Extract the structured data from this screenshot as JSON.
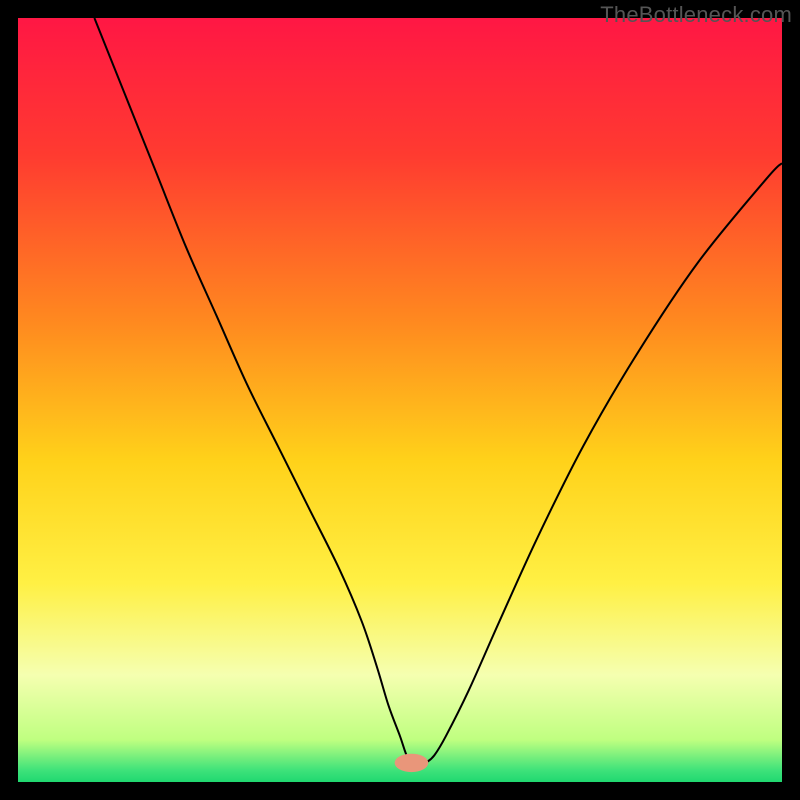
{
  "watermark": "TheBottleneck.com",
  "chart_data": {
    "type": "line",
    "title": "",
    "xlabel": "",
    "ylabel": "",
    "xlim": [
      0,
      100
    ],
    "ylim": [
      0,
      100
    ],
    "grid": false,
    "legend": false,
    "background_gradient": {
      "stops": [
        {
          "offset": 0.0,
          "color": "#ff1744"
        },
        {
          "offset": 0.18,
          "color": "#ff3b30"
        },
        {
          "offset": 0.4,
          "color": "#ff8a1f"
        },
        {
          "offset": 0.58,
          "color": "#ffd21a"
        },
        {
          "offset": 0.74,
          "color": "#fff044"
        },
        {
          "offset": 0.86,
          "color": "#f5ffb0"
        },
        {
          "offset": 0.945,
          "color": "#bfff80"
        },
        {
          "offset": 0.985,
          "color": "#3de27a"
        },
        {
          "offset": 1.0,
          "color": "#20d870"
        }
      ]
    },
    "marker": {
      "x": 51.5,
      "y": 2.5,
      "color": "#e9967a",
      "rx": 2.2,
      "ry": 1.2
    },
    "series": [
      {
        "name": "curve",
        "color": "#000000",
        "stroke_width": 2,
        "x": [
          10,
          14,
          18,
          22,
          26,
          30,
          34,
          38,
          42,
          45,
          47,
          48.5,
          50,
          51,
          52,
          53,
          53.5,
          54.5,
          56,
          59,
          63,
          68,
          74,
          81,
          89,
          98,
          100
        ],
        "y": [
          100,
          90,
          80,
          70,
          61,
          52,
          44,
          36,
          28,
          21,
          15,
          10,
          6,
          3.2,
          2.5,
          2.5,
          2.6,
          3.5,
          6,
          12,
          21,
          32,
          44,
          56,
          68,
          79,
          81
        ]
      }
    ]
  }
}
